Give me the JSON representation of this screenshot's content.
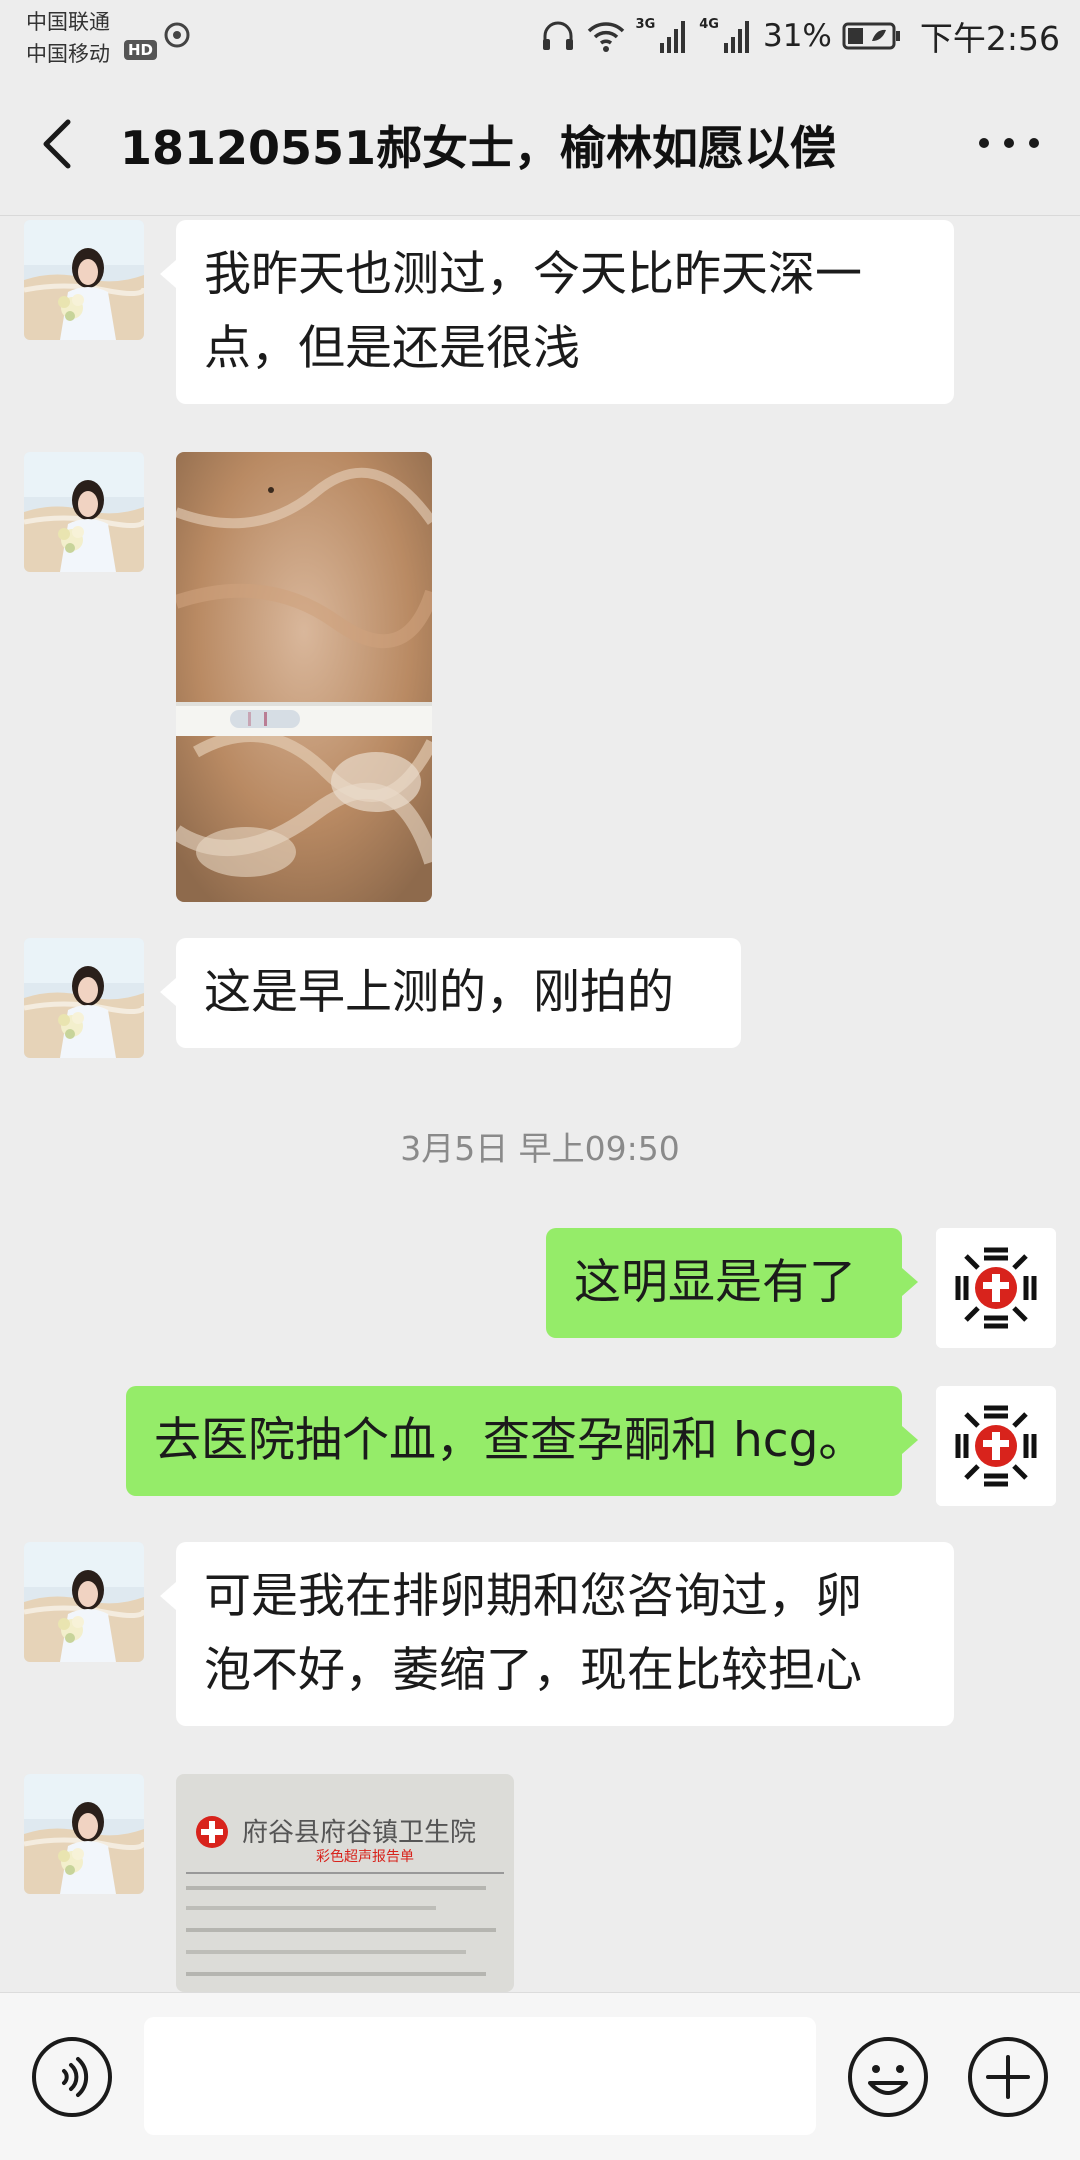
{
  "status_bar": {
    "carrier1": "中国联通",
    "carrier2": "中国移动",
    "hd": "HD",
    "net_3g": "3G",
    "net_4g": "4G",
    "battery_pct": "31%",
    "time": "下午2:56"
  },
  "header": {
    "title": "18120551郝女士，榆林如愿以偿"
  },
  "messages": [
    {
      "side": "in",
      "type": "text",
      "text": "我昨天也测过，今天比昨天深一点，但是还是很浅"
    },
    {
      "side": "in",
      "type": "image",
      "text": ""
    },
    {
      "side": "in",
      "type": "text",
      "text": "这是早上测的，刚拍的"
    },
    {
      "side": "out",
      "type": "text",
      "text": "这明显是有了"
    },
    {
      "side": "out",
      "type": "text",
      "text": "去医院抽个血，查查孕酮和 hcg。"
    },
    {
      "side": "in",
      "type": "text",
      "text": "可是我在排卵期和您咨询过，卵泡不好，萎缩了，现在比较担心"
    },
    {
      "side": "in",
      "type": "image",
      "text": ""
    }
  ],
  "msg1_line1": "我昨天也测过，今天比昨天深一",
  "msg1_line2": "点，但是还是很浅",
  "msg6_line1": "可是我在排卵期和您咨询过，卵",
  "msg6_line2": "泡不好，萎缩了，现在比较担心",
  "report_doc": {
    "hospital": "府谷县府谷镇卫生院",
    "subtitle": "彩色超声报告单"
  },
  "timestamp": "3月5日 早上09:50",
  "input_bar": {
    "placeholder": ""
  },
  "colors": {
    "background": "#ededed",
    "outgoing_bubble": "#95ec69",
    "incoming_bubble": "#ffffff",
    "logo_red": "#d8231c"
  }
}
